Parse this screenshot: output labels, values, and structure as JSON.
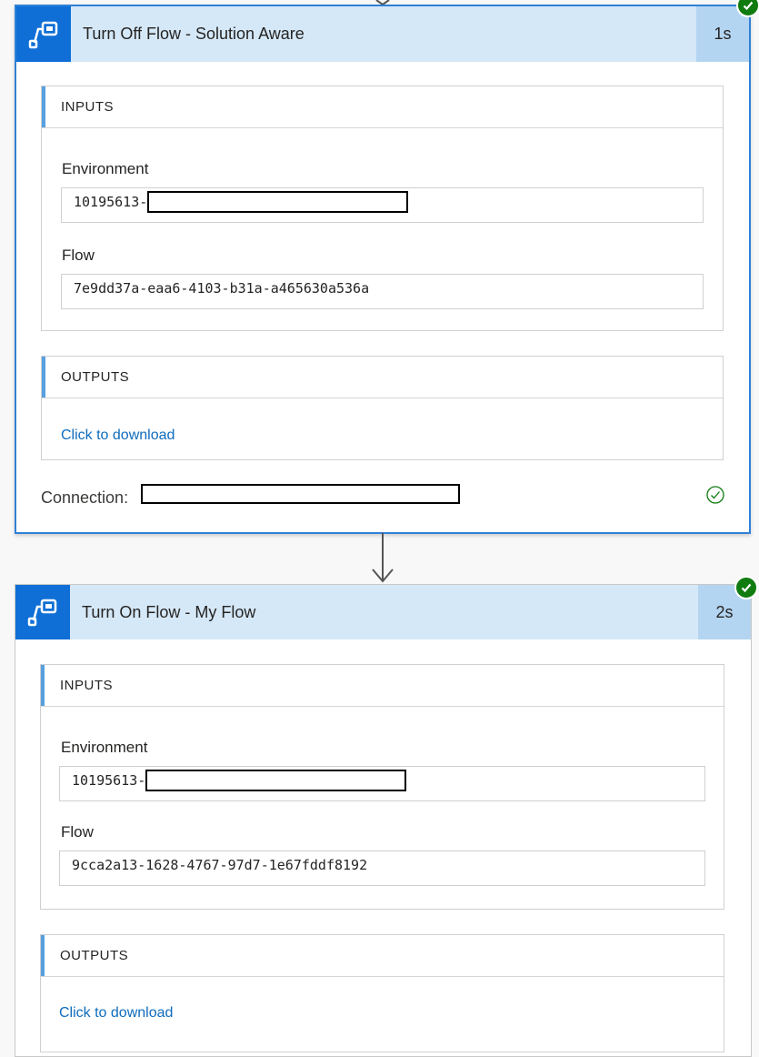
{
  "steps": [
    {
      "title": "Turn Off Flow - Solution Aware",
      "duration": "1s",
      "status": "succeeded",
      "inputs_heading": "INPUTS",
      "environment_label": "Environment",
      "environment_value": "10195613-",
      "flow_label": "Flow",
      "flow_value": "7e9dd37a-eaa6-4103-b31a-a465630a536a",
      "outputs_heading": "OUTPUTS",
      "download_link": "Click to download",
      "connection_label": "Connection:"
    },
    {
      "title": "Turn On Flow - My Flow",
      "duration": "2s",
      "status": "succeeded",
      "inputs_heading": "INPUTS",
      "environment_label": "Environment",
      "environment_value": "10195613-",
      "flow_label": "Flow",
      "flow_value": "9cca2a13-1628-4767-97d7-1e67fddf8192",
      "outputs_heading": "OUTPUTS",
      "download_link": "Click to download"
    }
  ],
  "icons": {
    "action": "power-automate-flow-icon",
    "status": "success-check-icon",
    "connection_status": "connection-ok-icon",
    "connector": "down-arrow-icon"
  },
  "colors": {
    "header_background": "#d5e8f8",
    "icon_background": "#0f6fd6",
    "duration_background": "#b4d5f1",
    "success": "#107c10",
    "link": "#0f6cbd",
    "selected_border": "#2f80d6"
  }
}
